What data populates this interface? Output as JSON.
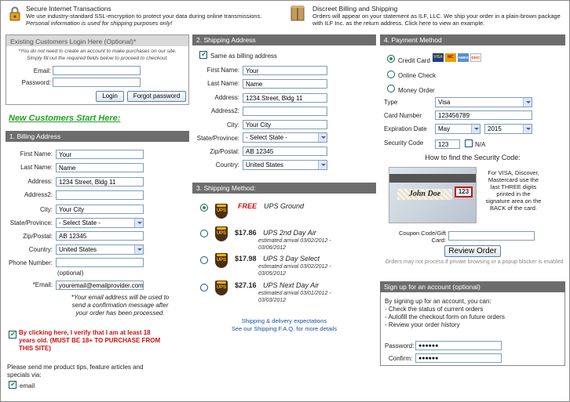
{
  "top": {
    "secure_title": "Secure Internet Transactions",
    "secure_text": "We use industry-standard SSL-encryption to protect your data during online transmissions.",
    "secure_text_italic": "Personal information is used for shipping purposes only!",
    "discreet_title": "Discreet Billing and Shipping",
    "discreet_text": "Orders will appear on your statement as ILF, LLC. We ship your order in a plain-brown package with ILF Inc. as the return address. Click here to view an example."
  },
  "login": {
    "header": "Existing Customers Login Here (Optional)*",
    "note1": "*You do not need to create an account to make purchases on our site.",
    "note2": "Simply fill out the required fields below to proceed to checkout.",
    "email_label": "Email:",
    "password_label": "Password:",
    "email_value": "",
    "password_value": "",
    "login_button": "Login",
    "forgot_button": "Forgot password"
  },
  "new_customers": "New Customers Start Here:",
  "billing": {
    "header": "1. Billing Address",
    "first_name_label": "First Name:",
    "first_name": "Your",
    "last_name_label": "Last Name:",
    "last_name": "Name",
    "address_label": "Address:",
    "address": "1234 Street, Bldg 11",
    "address2_label": "Address2:",
    "address2": "",
    "city_label": "City:",
    "city": "Your City",
    "state_label": "State/Province:",
    "state": "- Select State -",
    "zip_label": "Zip/Postal:",
    "zip": "AB 12345",
    "country_label": "Country:",
    "country": "United States",
    "phone_label": "Phone Number:",
    "phone": "",
    "phone_note": "(optional)",
    "email_label": "*Email:",
    "email": "youremail@emailprovider.com",
    "email_note1": "*Your email address will be used to",
    "email_note2": "send a confirmation message after",
    "email_note3": "your order has been processed.",
    "age_text1": "By clicking here, I verify that I am at least 18",
    "age_text2": "years old. (MUST BE 18+ TO PURCHASE FROM",
    "age_text3": "THIS SITE)",
    "tips_text1": "Please send me product tips, feature articles and",
    "tips_text2": "specials via:",
    "email_option": "email"
  },
  "shipping_address": {
    "header": "2. Shipping Address",
    "same_as_billing": "Same as billing address",
    "first_name_label": "First Name:",
    "first_name": "Your",
    "last_name_label": "Last Name:",
    "last_name": "Name",
    "address_label": "Address:",
    "address": "1234 Street, Bldg 11",
    "address2_label": "Address2:",
    "address2": "",
    "city_label": "City:",
    "city": "Your City",
    "state_label": "State/Province:",
    "state": "- Select State -",
    "zip_label": "Zip/Postal:",
    "zip": "AB 12345",
    "country_label": "Country:",
    "country": "United States"
  },
  "shipping_method": {
    "header": "3. Shipping Method:",
    "options": [
      {
        "price": "FREE",
        "name": "UPS Ground",
        "arrival": "",
        "arrival2": ""
      },
      {
        "price": "$17.86",
        "name": "UPS 2nd Day Air",
        "arrival": "estimated arrival 03/02/2012 -",
        "arrival2": "03/06/2012"
      },
      {
        "price": "$17.98",
        "name": "UPS 3 Day Select",
        "arrival": "estimated arrival 03/02/2012 -",
        "arrival2": "03/05/2012"
      },
      {
        "price": "$27.16",
        "name": "UPS Next Day Air",
        "arrival": "estimated arrival 03/01/2012 -",
        "arrival2": "03/03/2012"
      }
    ],
    "ups_logo": "UPS",
    "expectations_link": "Shipping & delivery expectations",
    "faq_link": "See our Shipping F.A.Q. for more details"
  },
  "payment": {
    "header": "4. Payment Method",
    "credit_card": "Credit Card",
    "online_check": "Online Check",
    "money_order": "Money Order",
    "card_logos": [
      "VISA",
      "MC",
      "AMEX",
      "DISC"
    ],
    "type_label": "Type",
    "type": "Visa",
    "card_number_label": "Card Number",
    "card_number": "123456789",
    "expiration_label": "Expiration Date",
    "exp_month": "May",
    "exp_year": "2015",
    "security_label": "Security Code",
    "security_code": "123",
    "na_label": "N/A",
    "how_to_find": "How to find the Security Code:",
    "card_sig": "John Doe",
    "card_code": "123",
    "security_help": "For VISA, Discover, Mastercard use the last THREE digits printed in the signature area on the BACK of the card.",
    "coupon_label1": "Coupon Code/Gift",
    "coupon_label2": "Card:",
    "coupon_value": "",
    "review_button": "Review Order",
    "popup_note": "Orders may not process if private browsing or a popup blocker is enabled"
  },
  "signup": {
    "header": "Sign up for an account (optional)",
    "intro": "By signing up for an account, you can:",
    "benefit1": "- Check the status of current orders",
    "benefit2": "- Autofill the checkout form on future orders",
    "benefit3": "- Review your order history",
    "password_label": "Password:",
    "password": "●●●●●●",
    "confirm_label": "Confirm:",
    "confirm": "●●●●●●"
  }
}
